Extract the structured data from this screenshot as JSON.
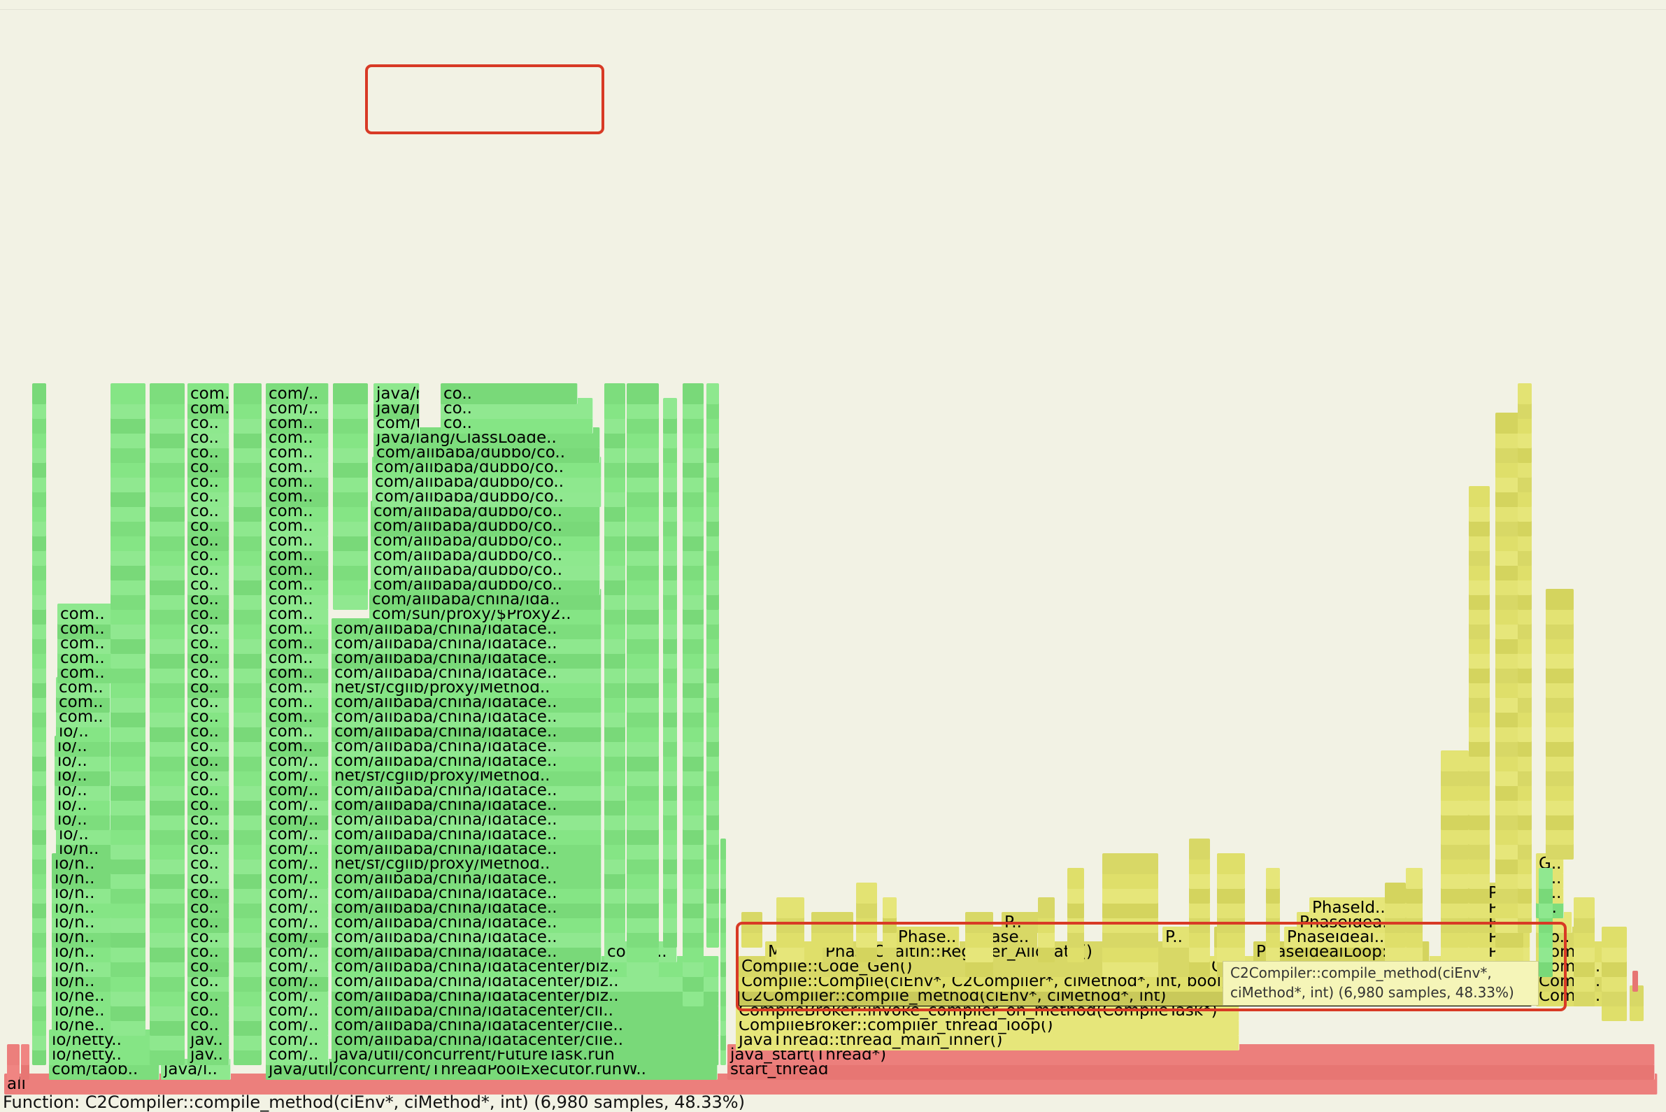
{
  "colors": {
    "background": "#f2f2e4",
    "java_green": "#85e585",
    "native_yellow": "#dfdf6a",
    "kernel_red": "#ec7f7c",
    "highlight_box": "#d83a25",
    "tooltip_bg": "#f5f5b8"
  },
  "status": {
    "text": "Function: C2Compiler::compile_method(ciEnv*, ciMethod*, int) (6,980 samples, 48.33%)"
  },
  "tooltip": {
    "line1": "C2Compiler::compile_method(ciEnv*,",
    "line2": "ciMethod*, int) (6,980 samples, 48.33%)"
  },
  "frames": [
    {
      "text": "all",
      "kind": "red"
    },
    {
      "text": "com/taob..",
      "kind": "green"
    },
    {
      "text": "java/l..",
      "kind": "green"
    },
    {
      "text": "java/util/concurrent/ThreadPoolExecutor.runW..",
      "kind": "green"
    },
    {
      "text": "start_thread",
      "kind": "red"
    },
    {
      "text": "io/netty..",
      "kind": "green"
    },
    {
      "text": "jav..",
      "kind": "green"
    },
    {
      "text": "com/..",
      "kind": "green"
    },
    {
      "text": "java/util/concurrent/FutureTask.run",
      "kind": "green"
    },
    {
      "text": "java_start(Thread*)",
      "kind": "red"
    },
    {
      "text": "io/netty..",
      "kind": "green"
    },
    {
      "text": "jav..",
      "kind": "green"
    },
    {
      "text": "com/..",
      "kind": "green"
    },
    {
      "text": "com/alibaba/china/idatacenter/clie..",
      "kind": "green"
    },
    {
      "text": "JavaThread::thread_main_inner()",
      "kind": "yellow"
    },
    {
      "text": "io/ne..",
      "kind": "green"
    },
    {
      "text": "co..",
      "kind": "green"
    },
    {
      "text": "com/..",
      "kind": "green"
    },
    {
      "text": "com/alibaba/china/idatacenter/clie..",
      "kind": "green"
    },
    {
      "text": "CompileBroker::compiler_thread_loop()",
      "kind": "yellow"
    },
    {
      "text": "io/ne..",
      "kind": "green"
    },
    {
      "text": "co..",
      "kind": "green"
    },
    {
      "text": "com/..",
      "kind": "green"
    },
    {
      "text": "com/alibaba/china/idatacenter/cli..",
      "kind": "green"
    },
    {
      "text": "CompileBroker::invoke_compiler_on_method(CompileTask*)",
      "kind": "yellow"
    },
    {
      "text": "io/ne..",
      "kind": "green"
    },
    {
      "text": "co..",
      "kind": "green"
    },
    {
      "text": "com/..",
      "kind": "green"
    },
    {
      "text": "com/alibaba/china/idatacenter/biz..",
      "kind": "green"
    },
    {
      "text": "C2Compiler::compile_method(ciEnv*, ciMethod*, int)",
      "kind": "yellow"
    },
    {
      "text": "Compi..",
      "kind": "yellow"
    },
    {
      "text": "io/n..",
      "kind": "green"
    },
    {
      "text": "co..",
      "kind": "green"
    },
    {
      "text": "com/..",
      "kind": "green"
    },
    {
      "text": "com/alibaba/china/idatacenter/biz..",
      "kind": "green"
    },
    {
      "text": "Compile::Compile(ciEnv*, C2Compiler*, ciMethod*, int, bool, bool, bool)",
      "kind": "yellow"
    },
    {
      "text": "Compi..",
      "kind": "yellow"
    },
    {
      "text": "io/n..",
      "kind": "green"
    },
    {
      "text": "co..",
      "kind": "green"
    },
    {
      "text": "com/..",
      "kind": "green"
    },
    {
      "text": "com/alibaba/china/idatacenter/biz..",
      "kind": "green"
    },
    {
      "text": "Compile::Code_Gen()",
      "kind": "yellow"
    },
    {
      "text": "Compile::Optimize()",
      "kind": "yellow"
    },
    {
      "text": "Pa..",
      "kind": "yellow"
    },
    {
      "text": "Compi..",
      "kind": "yellow"
    },
    {
      "text": "io/n..",
      "kind": "green"
    },
    {
      "text": "co..",
      "kind": "green"
    },
    {
      "text": "com/..",
      "kind": "green"
    },
    {
      "text": "com/alibaba/china/idatace..",
      "kind": "green"
    },
    {
      "text": "com/a..",
      "kind": "green"
    },
    {
      "text": "M..",
      "kind": "yellow"
    },
    {
      "text": "PhaseChaitin::Register_Allocate()",
      "kind": "yellow"
    },
    {
      "text": "C..",
      "kind": "yellow"
    },
    {
      "text": "PhaseIdealLoop::b..",
      "kind": "yellow"
    },
    {
      "text": "Pa..",
      "kind": "yellow"
    },
    {
      "text": "Comp..",
      "kind": "yellow"
    },
    {
      "text": "io/n..",
      "kind": "green"
    },
    {
      "text": "co..",
      "kind": "green"
    },
    {
      "text": "com/..",
      "kind": "green"
    },
    {
      "text": "com/alibaba/china/idatace..",
      "kind": "green"
    },
    {
      "text": "Phase..",
      "kind": "yellow"
    },
    {
      "text": "Phase..",
      "kind": "yellow"
    },
    {
      "text": "P..",
      "kind": "yellow"
    },
    {
      "text": "C..",
      "kind": "yellow"
    },
    {
      "text": "PhaseIdeal..",
      "kind": "yellow"
    },
    {
      "text": "Pa..",
      "kind": "yellow"
    },
    {
      "text": "Co..",
      "kind": "yellow"
    },
    {
      "text": "io/n..",
      "kind": "green"
    },
    {
      "text": "co..",
      "kind": "green"
    },
    {
      "text": "com/..",
      "kind": "green"
    },
    {
      "text": "com/alibaba/china/idatace..",
      "kind": "green"
    },
    {
      "text": "P..",
      "kind": "yellow"
    },
    {
      "text": "PhaseIdea..",
      "kind": "yellow"
    },
    {
      "text": "Pa..",
      "kind": "yellow"
    },
    {
      "text": "I..",
      "kind": "yellow"
    },
    {
      "text": "io/n..",
      "kind": "green"
    },
    {
      "text": "co..",
      "kind": "green"
    },
    {
      "text": "com/..",
      "kind": "green"
    },
    {
      "text": "com/alibaba/china/idatace..",
      "kind": "green"
    },
    {
      "text": "PhaseId..",
      "kind": "yellow"
    },
    {
      "text": "Pa..",
      "kind": "yellow"
    },
    {
      "text": "T..",
      "kind": "green"
    },
    {
      "text": "io/n..",
      "kind": "green"
    },
    {
      "text": "co..",
      "kind": "green"
    },
    {
      "text": "com/..",
      "kind": "green"
    },
    {
      "text": "com/alibaba/china/idatace..",
      "kind": "green"
    },
    {
      "text": "Pa..",
      "kind": "yellow"
    },
    {
      "text": "G..",
      "kind": "yellow"
    },
    {
      "text": "io/n..",
      "kind": "green"
    },
    {
      "text": "co..",
      "kind": "green"
    },
    {
      "text": "com/..",
      "kind": "green"
    },
    {
      "text": "com/alibaba/china/idatace..",
      "kind": "green"
    },
    {
      "text": "G..",
      "kind": "yellow"
    },
    {
      "text": "io/n..",
      "kind": "green"
    },
    {
      "text": "co..",
      "kind": "green"
    },
    {
      "text": "com/..",
      "kind": "green"
    },
    {
      "text": "net/sf/cglib/proxy/Method..",
      "kind": "green"
    },
    {
      "text": "G..",
      "kind": "yellow"
    },
    {
      "text": "io/n..",
      "kind": "green"
    },
    {
      "text": "co..",
      "kind": "green"
    },
    {
      "text": "com/..",
      "kind": "green"
    },
    {
      "text": "com/alibaba/china/idatace..",
      "kind": "green"
    },
    {
      "text": "io/..",
      "kind": "green"
    },
    {
      "text": "co..",
      "kind": "green"
    },
    {
      "text": "com/..",
      "kind": "green"
    },
    {
      "text": "com/alibaba/china/idatace..",
      "kind": "green"
    },
    {
      "text": "io/..",
      "kind": "green"
    },
    {
      "text": "co..",
      "kind": "green"
    },
    {
      "text": "com/..",
      "kind": "green"
    },
    {
      "text": "com/alibaba/china/idatace..",
      "kind": "green"
    },
    {
      "text": "io/..",
      "kind": "green"
    },
    {
      "text": "co..",
      "kind": "green"
    },
    {
      "text": "com/..",
      "kind": "green"
    },
    {
      "text": "com/alibaba/china/idatace..",
      "kind": "green"
    },
    {
      "text": "io/..",
      "kind": "green"
    },
    {
      "text": "co..",
      "kind": "green"
    },
    {
      "text": "com/..",
      "kind": "green"
    },
    {
      "text": "com/alibaba/china/idatace..",
      "kind": "green"
    },
    {
      "text": "io/..",
      "kind": "green"
    },
    {
      "text": "co..",
      "kind": "green"
    },
    {
      "text": "com/..",
      "kind": "green"
    },
    {
      "text": "net/sf/cglib/proxy/Method..",
      "kind": "green"
    },
    {
      "text": "io/..",
      "kind": "green"
    },
    {
      "text": "co..",
      "kind": "green"
    },
    {
      "text": "com/..",
      "kind": "green"
    },
    {
      "text": "com/alibaba/china/idatace..",
      "kind": "green"
    },
    {
      "text": "io/..",
      "kind": "green"
    },
    {
      "text": "co..",
      "kind": "green"
    },
    {
      "text": "com..",
      "kind": "green"
    },
    {
      "text": "com/alibaba/china/idatace..",
      "kind": "green"
    },
    {
      "text": "io/..",
      "kind": "green"
    },
    {
      "text": "co..",
      "kind": "green"
    },
    {
      "text": "com..",
      "kind": "green"
    },
    {
      "text": "com/alibaba/china/idatace..",
      "kind": "green"
    },
    {
      "text": "com..",
      "kind": "green"
    },
    {
      "text": "co..",
      "kind": "green"
    },
    {
      "text": "com..",
      "kind": "green"
    },
    {
      "text": "com/alibaba/china/idatace..",
      "kind": "green"
    },
    {
      "text": "com..",
      "kind": "green"
    },
    {
      "text": "co..",
      "kind": "green"
    },
    {
      "text": "com..",
      "kind": "green"
    },
    {
      "text": "com/alibaba/china/idatace..",
      "kind": "green"
    },
    {
      "text": "com..",
      "kind": "green"
    },
    {
      "text": "co..",
      "kind": "green"
    },
    {
      "text": "com..",
      "kind": "green"
    },
    {
      "text": "net/sf/cglib/proxy/Method..",
      "kind": "green"
    },
    {
      "text": "com..",
      "kind": "green"
    },
    {
      "text": "co..",
      "kind": "green"
    },
    {
      "text": "com..",
      "kind": "green"
    },
    {
      "text": "com/alibaba/china/idatace..",
      "kind": "green"
    },
    {
      "text": "com..",
      "kind": "green"
    },
    {
      "text": "co..",
      "kind": "green"
    },
    {
      "text": "com..",
      "kind": "green"
    },
    {
      "text": "com/alibaba/china/idatace..",
      "kind": "green"
    },
    {
      "text": "com..",
      "kind": "green"
    },
    {
      "text": "co..",
      "kind": "green"
    },
    {
      "text": "com..",
      "kind": "green"
    },
    {
      "text": "com/alibaba/china/idatace..",
      "kind": "green"
    },
    {
      "text": "com..",
      "kind": "green"
    },
    {
      "text": "co..",
      "kind": "green"
    },
    {
      "text": "com..",
      "kind": "green"
    },
    {
      "text": "com/alibaba/china/idatace..",
      "kind": "green"
    },
    {
      "text": "com..",
      "kind": "green"
    },
    {
      "text": "co..",
      "kind": "green"
    },
    {
      "text": "com..",
      "kind": "green"
    },
    {
      "text": "com/sun/proxy/$Proxy2..",
      "kind": "green"
    },
    {
      "text": "co..",
      "kind": "green"
    },
    {
      "text": "com..",
      "kind": "green"
    },
    {
      "text": "com/alibaba/china/ida..",
      "kind": "green"
    },
    {
      "text": "co..",
      "kind": "green"
    },
    {
      "text": "com..",
      "kind": "green"
    },
    {
      "text": "com/alibaba/dubbo/co..",
      "kind": "green"
    },
    {
      "text": "co..",
      "kind": "green"
    },
    {
      "text": "com..",
      "kind": "green"
    },
    {
      "text": "com/alibaba/dubbo/co..",
      "kind": "green"
    },
    {
      "text": "co..",
      "kind": "green"
    },
    {
      "text": "com..",
      "kind": "green"
    },
    {
      "text": "com/alibaba/dubbo/co..",
      "kind": "green"
    },
    {
      "text": "co..",
      "kind": "green"
    },
    {
      "text": "com..",
      "kind": "green"
    },
    {
      "text": "com/alibaba/dubbo/co..",
      "kind": "green"
    },
    {
      "text": "co..",
      "kind": "green"
    },
    {
      "text": "com..",
      "kind": "green"
    },
    {
      "text": "com/alibaba/dubbo/co..",
      "kind": "green"
    },
    {
      "text": "co..",
      "kind": "green"
    },
    {
      "text": "com..",
      "kind": "green"
    },
    {
      "text": "com/alibaba/dubbo/co..",
      "kind": "green"
    },
    {
      "text": "co..",
      "kind": "green"
    },
    {
      "text": "com..",
      "kind": "green"
    },
    {
      "text": "com/alibaba/dubbo/co..",
      "kind": "green"
    },
    {
      "text": "co..",
      "kind": "green"
    },
    {
      "text": "com..",
      "kind": "green"
    },
    {
      "text": "com/alibaba/dubbo/co..",
      "kind": "green"
    },
    {
      "text": "co..",
      "kind": "green"
    },
    {
      "text": "com..",
      "kind": "green"
    },
    {
      "text": "com/alibaba/dubbo/co..",
      "kind": "green"
    },
    {
      "text": "co..",
      "kind": "green"
    },
    {
      "text": "com..",
      "kind": "green"
    },
    {
      "text": "com/alibaba/dubbo/co..",
      "kind": "green"
    },
    {
      "text": "co..",
      "kind": "green"
    },
    {
      "text": "com..",
      "kind": "green"
    },
    {
      "text": "java/lang/ClassLoade..",
      "kind": "green"
    },
    {
      "text": "co..",
      "kind": "green"
    },
    {
      "text": "com..",
      "kind": "green"
    },
    {
      "text": "com/taobao/pandora/b..",
      "kind": "green"
    },
    {
      "text": "co..",
      "kind": "green"
    },
    {
      "text": "com..",
      "kind": "green"
    },
    {
      "text": "com/..",
      "kind": "green"
    },
    {
      "text": "java/lang/Cla..",
      "kind": "green"
    },
    {
      "text": "co..",
      "kind": "green"
    },
    {
      "text": "com..",
      "kind": "green"
    },
    {
      "text": "com/..",
      "kind": "green"
    },
    {
      "text": "java/net/URL..",
      "kind": "green"
    },
    {
      "text": "co..",
      "kind": "green"
    },
    {
      "text": "com..",
      "kind": "green"
    },
    {
      "text": "jav..",
      "kind": "green"
    },
    {
      "text": "java/securi..",
      "kind": "green"
    }
  ]
}
